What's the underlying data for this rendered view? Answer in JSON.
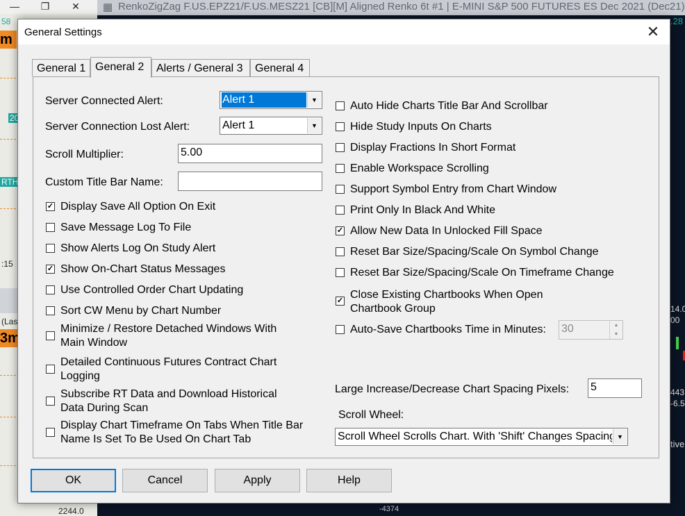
{
  "background": {
    "window_title": "RenkoZigZag F.US.EPZ21/F.US.MESZ21 [CB][M]  Aligned Renko 6t  #1 | E-MINI S&P 500 FUTURES ES Dec 2021 (Dec21)",
    "left_tags": {
      "t1": "58",
      "t2": "m",
      "t3": "20",
      "t4": "RTH",
      "t5": ":15",
      "t6": "(Las",
      "t7": "3m",
      "t8": "2244.0"
    },
    "right_tags": {
      "r1": ".28",
      "r2": "14.0",
      "r3": "00",
      "r4": "443",
      "r5": "-6.5",
      "r6": "tive"
    },
    "bottom_label": "-4374",
    "colors": {
      "orange": "#f08a24",
      "teal": "#23a8a0",
      "chart_bg": "#0b1424"
    }
  },
  "dialog": {
    "title": "General Settings",
    "close_icon": "close-icon",
    "tabs": [
      "General 1",
      "General 2",
      "Alerts / General 3",
      "General 4"
    ],
    "active_tab": "General 2",
    "left": {
      "server_connected_alert": {
        "label": "Server Connected Alert:",
        "value": "Alert 1"
      },
      "server_connection_lost_alert": {
        "label": "Server Connection Lost Alert:",
        "value": "Alert 1"
      },
      "scroll_multiplier": {
        "label": "Scroll Multiplier:",
        "value": "5.00"
      },
      "custom_title_bar_name": {
        "label": "Custom Title Bar Name:",
        "value": ""
      },
      "checkboxes": [
        {
          "label": "Display Save All Option On Exit",
          "checked": true
        },
        {
          "label": "Save Message Log To File",
          "checked": false
        },
        {
          "label": "Show Alerts Log On Study Alert",
          "checked": false
        },
        {
          "label": "Show On-Chart Status Messages",
          "checked": true
        },
        {
          "label": "Use Controlled Order Chart Updating",
          "checked": false
        },
        {
          "label": "Sort CW Menu by Chart Number",
          "checked": false
        },
        {
          "label_line1": "Minimize / Restore Detached Windows With",
          "label_line2": "Main Window",
          "checked": false
        },
        {
          "label_line1": "Detailed Continuous Futures Contract Chart",
          "label_line2": "Logging",
          "checked": false
        },
        {
          "label_line1": "Subscribe RT Data and Download Historical",
          "label_line2": "Data During Scan",
          "checked": false
        },
        {
          "label_line1": "Display Chart Timeframe On Tabs When Title Bar",
          "label_line2": "Name Is Set To Be Used On Chart Tab",
          "checked": false
        }
      ]
    },
    "right": {
      "checkboxes": [
        {
          "label": "Auto Hide Charts Title Bar And Scrollbar",
          "checked": false
        },
        {
          "label": "Hide Study Inputs On Charts",
          "checked": false
        },
        {
          "label": "Display Fractions In Short Format",
          "checked": false
        },
        {
          "label": "Enable Workspace Scrolling",
          "checked": false
        },
        {
          "label": "Support Symbol Entry from Chart Window",
          "checked": false
        },
        {
          "label": "Print Only In Black And White",
          "checked": false
        },
        {
          "label": "Allow New Data In Unlocked Fill Space",
          "checked": true
        },
        {
          "label": "Reset Bar Size/Spacing/Scale On Symbol Change",
          "checked": false
        },
        {
          "label": "Reset Bar Size/Spacing/Scale On Timeframe Change",
          "checked": false
        },
        {
          "label_line1": "Close Existing Chartbooks When Open",
          "label_line2": "Chartbook Group",
          "checked": true
        }
      ],
      "auto_save": {
        "label": "Auto-Save Chartbooks Time in Minutes:",
        "value": "30",
        "checked": false
      },
      "spacing_pixels": {
        "label": "Large Increase/Decrease Chart Spacing Pixels:",
        "value": "5"
      },
      "scroll_wheel": {
        "label": "Scroll Wheel:",
        "value": "Scroll Wheel Scrolls Chart. With 'Shift' Changes Spacing"
      }
    },
    "buttons": {
      "ok": "OK",
      "cancel": "Cancel",
      "apply": "Apply",
      "help": "Help"
    }
  }
}
